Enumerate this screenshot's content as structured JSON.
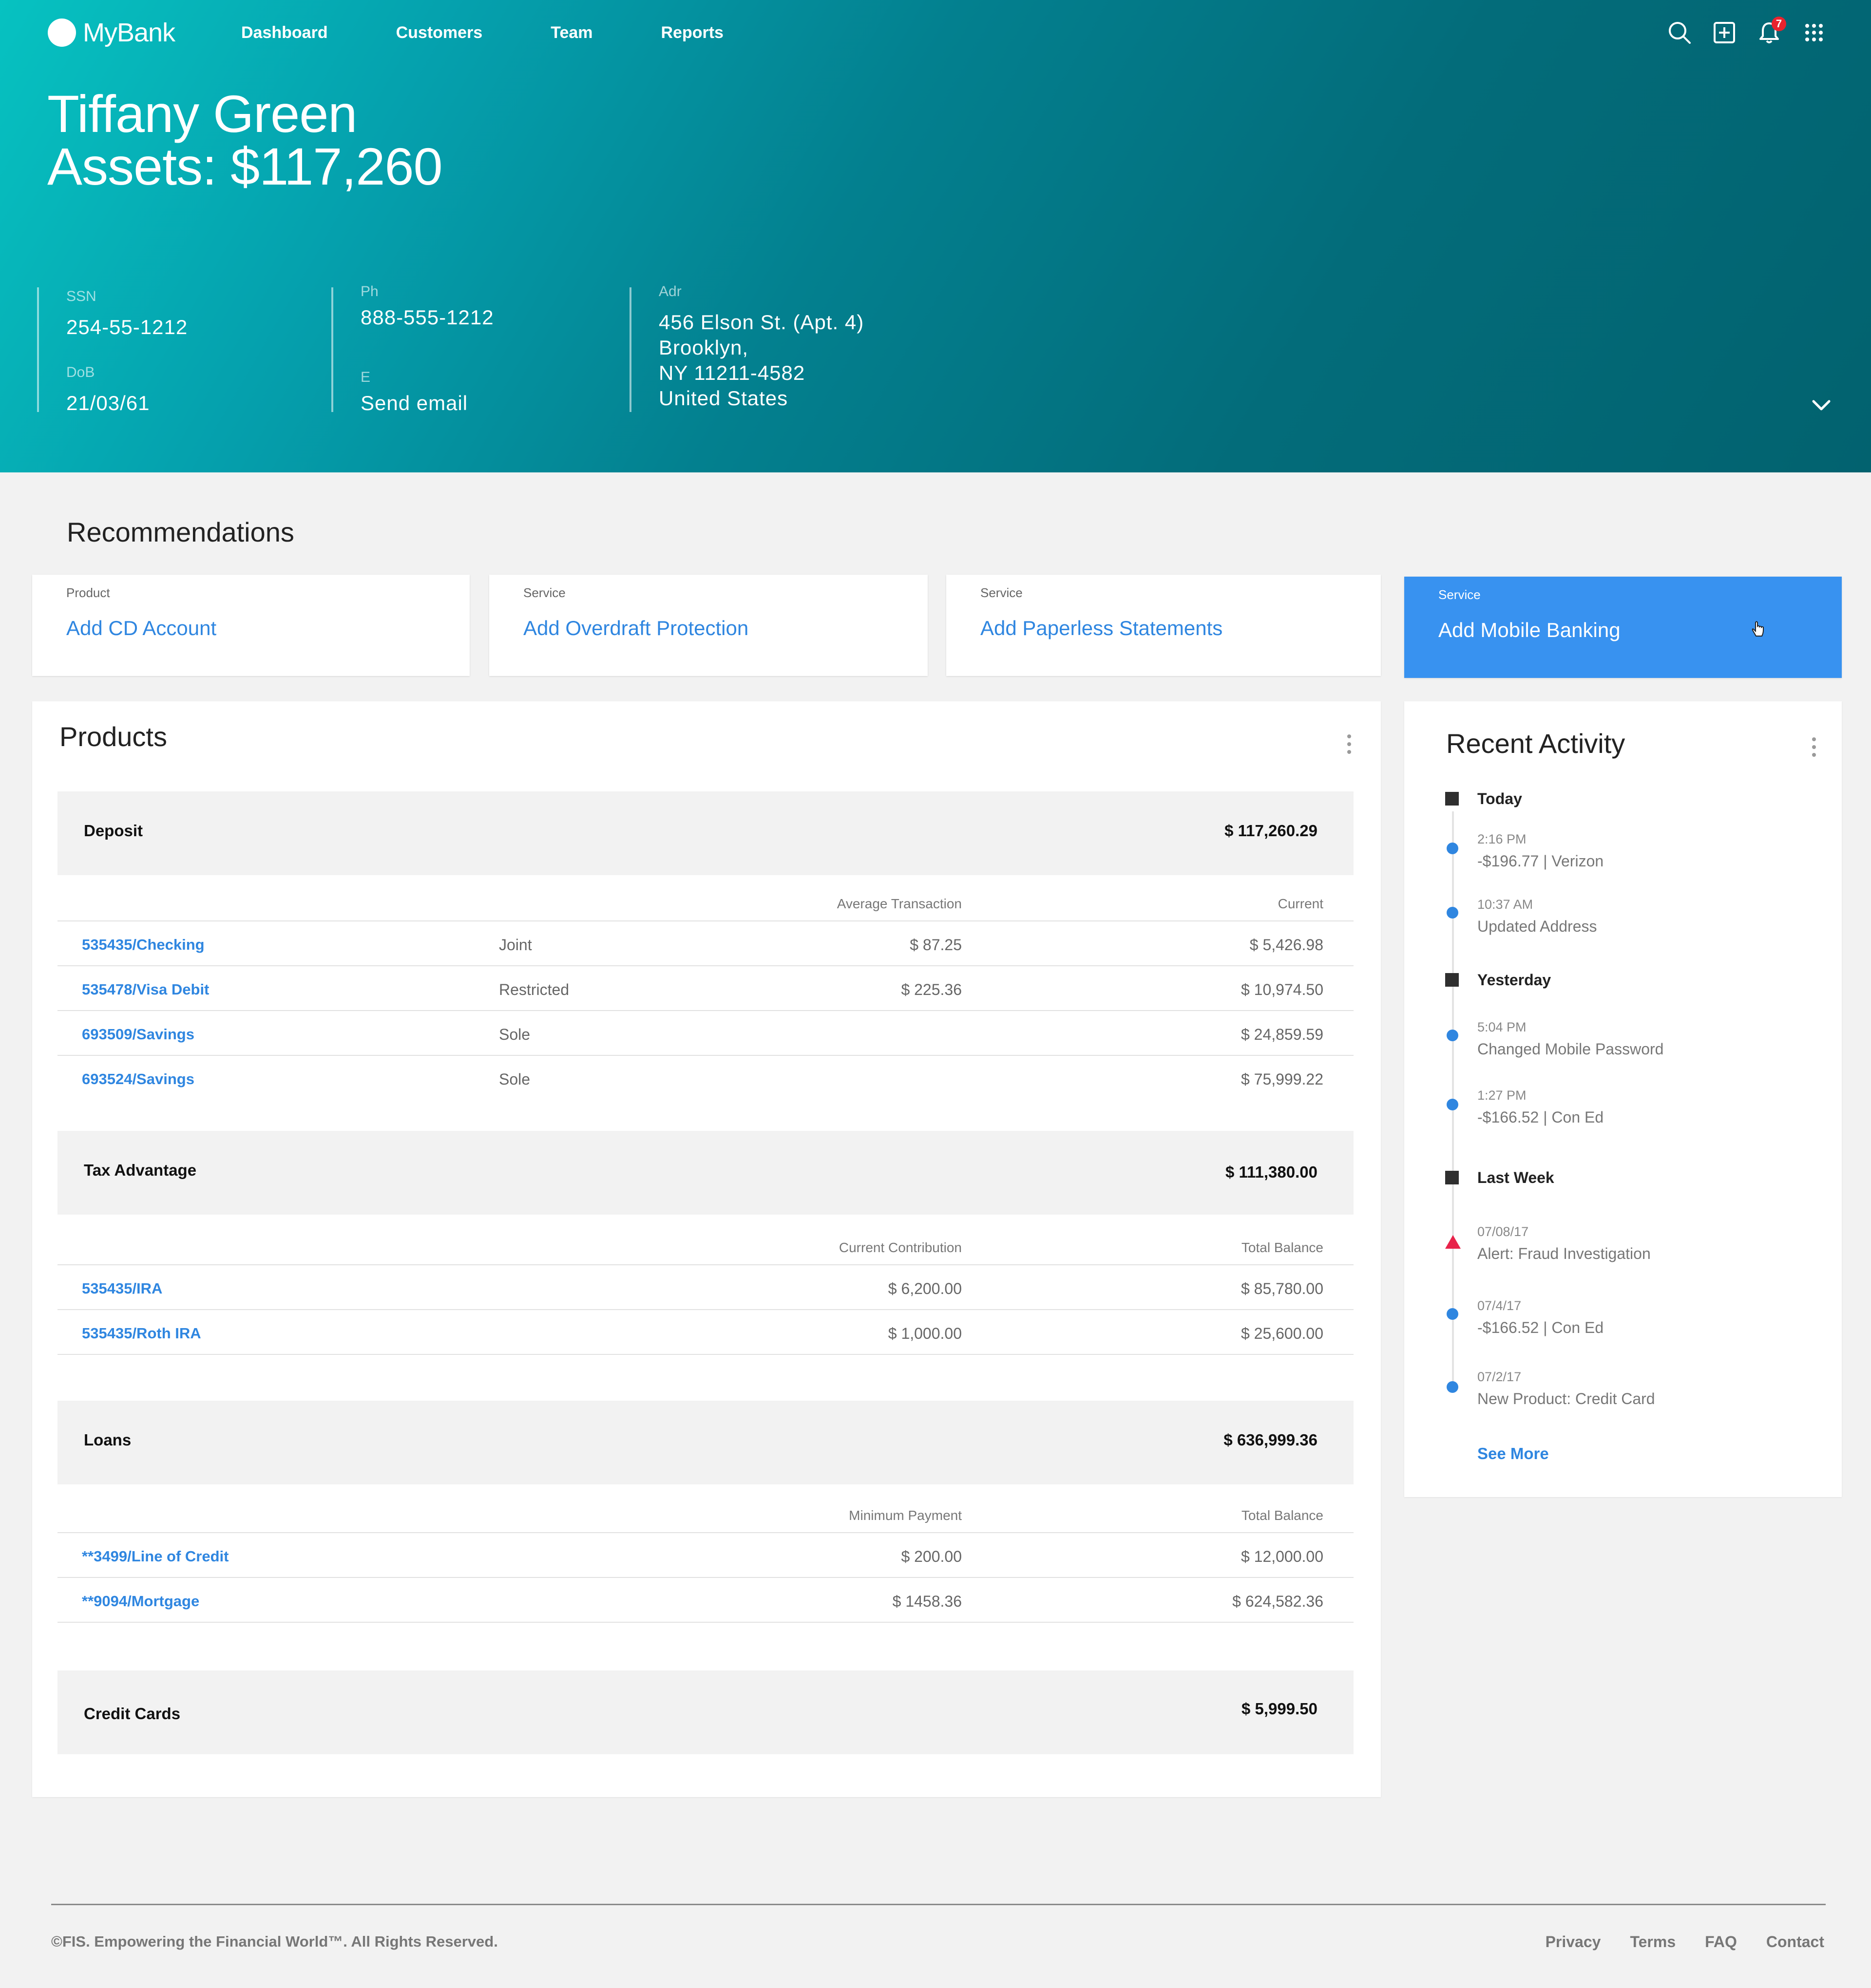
{
  "app": {
    "brand": "MyBank",
    "nav": [
      "Dashboard",
      "Customers",
      "Team",
      "Reports"
    ],
    "notifications_count": "7",
    "icons": [
      "search-icon",
      "add-icon",
      "bell-icon",
      "apps-grid-icon"
    ]
  },
  "customer": {
    "name": "Tiffany Green",
    "assets": "Assets: $117,260",
    "ssn_label": "SSN",
    "ssn": "254-55-1212",
    "dob_label": "DoB",
    "dob": "21/03/61",
    "phone_label": "Ph",
    "phone": "888-555-1212",
    "email_label": "E",
    "email": "Send email",
    "address_label": "Adr",
    "address_lines": [
      "456 Elson St. (Apt. 4)",
      "Brooklyn,",
      "NY 11211-4582",
      "United States"
    ]
  },
  "recommendations": {
    "title": "Recommendations",
    "items": [
      {
        "kind": "Product",
        "label": "Add CD Account"
      },
      {
        "kind": "Service",
        "label": "Add Overdraft Protection"
      },
      {
        "kind": "Service",
        "label": "Add Paperless Statements"
      },
      {
        "kind": "Service",
        "label": "Add Mobile Banking"
      }
    ]
  },
  "products": {
    "title": "Products",
    "groups": [
      {
        "name": "Deposit",
        "total": "$ 117,260.29",
        "col1": "Average Transaction",
        "col2": "Current",
        "rows": [
          {
            "acct": "535435/Checking",
            "type": "Joint",
            "c1": "$ 87.25",
            "c2": "$ 5,426.98"
          },
          {
            "acct": "535478/Visa Debit",
            "type": "Restricted",
            "c1": "$ 225.36",
            "c2": "$ 10,974.50"
          },
          {
            "acct": "693509/Savings",
            "type": "Sole",
            "c1": "",
            "c2": "$ 24,859.59"
          },
          {
            "acct": "693524/Savings",
            "type": "Sole",
            "c1": "",
            "c2": "$ 75,999.22"
          }
        ]
      },
      {
        "name": "Tax Advantage",
        "total": "$ 111,380.00",
        "col1": "Current Contribution",
        "col2": "Total Balance",
        "rows": [
          {
            "acct": "535435/IRA",
            "type": "",
            "c1": "$ 6,200.00",
            "c2": "$ 85,780.00"
          },
          {
            "acct": "535435/Roth IRA",
            "type": "",
            "c1": "$ 1,000.00",
            "c2": "$ 25,600.00"
          }
        ]
      },
      {
        "name": "Loans",
        "total": "$ 636,999.36",
        "col1": "Minimum Payment",
        "col2": "Total Balance",
        "rows": [
          {
            "acct": "**3499/Line of Credit",
            "type": "",
            "c1": "$ 200.00",
            "c2": "$ 12,000.00"
          },
          {
            "acct": "**9094/Mortgage",
            "type": "",
            "c1": "$ 1458.36",
            "c2": "$ 624,582.36"
          }
        ]
      },
      {
        "name": "Credit Cards",
        "total": "$ 5,999.50",
        "col1": "",
        "col2": "",
        "rows": []
      }
    ]
  },
  "activity": {
    "title": "Recent Activity",
    "sections": [
      {
        "heading": "Today",
        "items": [
          {
            "time": "2:16 PM",
            "desc": "-$196.77  |  Verizon",
            "marker": "dot"
          },
          {
            "time": "10:37 AM",
            "desc": "Updated Address",
            "marker": "dot"
          }
        ]
      },
      {
        "heading": "Yesterday",
        "items": [
          {
            "time": "5:04 PM",
            "desc": "Changed Mobile Password",
            "marker": "dot"
          },
          {
            "time": "1:27 PM",
            "desc": "-$166.52  |  Con Ed",
            "marker": "dot"
          }
        ]
      },
      {
        "heading": "Last Week",
        "items": [
          {
            "time": "07/08/17",
            "desc": "Alert: Fraud Investigation",
            "marker": "alert"
          },
          {
            "time": "07/4/17",
            "desc": "-$166.52  |  Con Ed",
            "marker": "dot"
          },
          {
            "time": "07/2/17",
            "desc": "New Product: Credit Card",
            "marker": "dot"
          }
        ]
      }
    ],
    "see_more": "See More"
  },
  "footer": {
    "copyright": "©FIS. Empowering the Financial World™. All Rights Reserved.",
    "links": [
      "Privacy",
      "Terms",
      "FAQ",
      "Contact"
    ]
  },
  "colors": {
    "accent_blue": "#2f86e0",
    "active_card": "#3892f0",
    "hero_teal_start": "#06c2c1",
    "hero_teal_end": "#02626f",
    "alert_red": "#e8234a",
    "badge_red": "#e8232e"
  }
}
